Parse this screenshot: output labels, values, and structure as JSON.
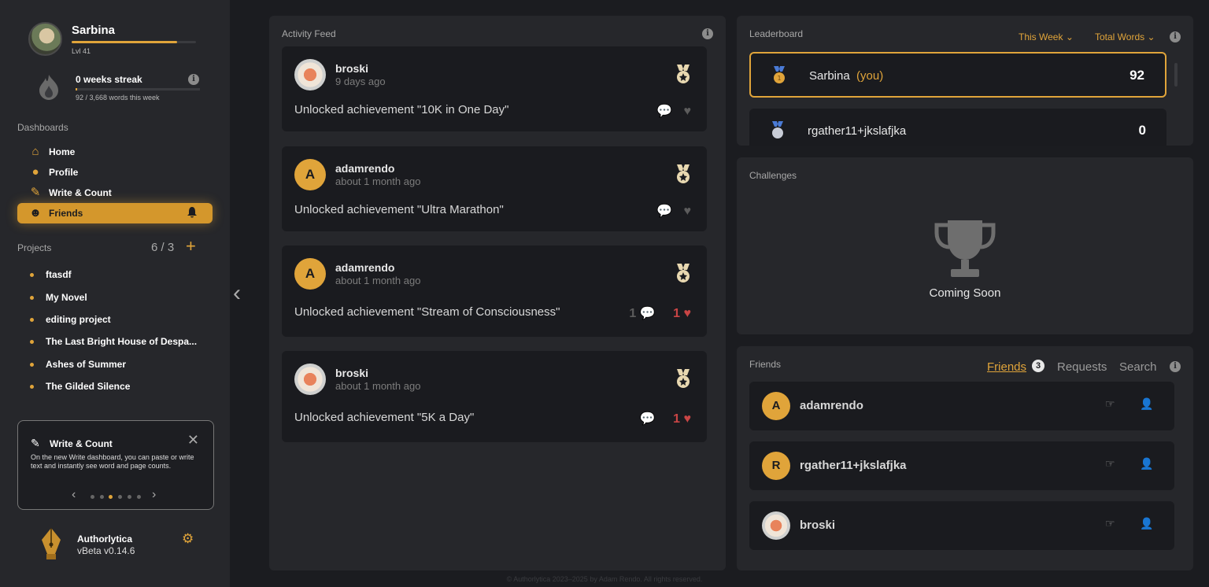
{
  "user": {
    "name": "Sarbina",
    "level": "Lvl 41"
  },
  "streak": {
    "title": "0 weeks streak",
    "sub": "92 / 3,668 words this week"
  },
  "sidebar": {
    "dashboards_label": "Dashboards",
    "nav": [
      {
        "label": "Home",
        "icon": "home-icon"
      },
      {
        "label": "Profile",
        "icon": "user-icon"
      },
      {
        "label": "Write & Count",
        "icon": "pencil-ruler-icon"
      },
      {
        "label": "Friends",
        "icon": "users-icon"
      }
    ],
    "projects_label": "Projects",
    "projects_count": "6 / 3",
    "projects": [
      "ftasdf",
      "My Novel",
      "editing project",
      "The Last Bright House of Despa...",
      "Ashes of Summer",
      "The Gilded Silence"
    ]
  },
  "tip": {
    "title": "Write & Count",
    "body": "On the new Write dashboard, you can paste or write text and instantly see word and page counts.",
    "close": "✕"
  },
  "brand": {
    "name": "Authorlytica",
    "version": "vBeta v0.14.6"
  },
  "activity": {
    "title": "Activity Feed",
    "items": [
      {
        "user": "broski",
        "time": "9 days ago",
        "text": "Unlocked achievement \"10K in One Day\"",
        "comments": "",
        "likes": ""
      },
      {
        "user": "adamrendo",
        "initial": "A",
        "time": "about 1 month ago",
        "text": "Unlocked achievement \"Ultra Marathon\"",
        "comments": "",
        "likes": ""
      },
      {
        "user": "adamrendo",
        "initial": "A",
        "time": "about 1 month ago",
        "text": "Unlocked achievement \"Stream of Consciousness\"",
        "comments": "1",
        "likes": "1"
      },
      {
        "user": "broski",
        "time": "about 1 month ago",
        "text": "Unlocked achievement \"5K a Day\"",
        "comments": "",
        "likes": "1"
      }
    ]
  },
  "leaderboard": {
    "title": "Leaderboard",
    "period": "This Week",
    "metric": "Total Words",
    "rows": [
      {
        "name": "Sarbina",
        "you": "(you)",
        "score": "92"
      },
      {
        "name": "rgather11+jkslafjka",
        "score": "0"
      }
    ]
  },
  "challenges": {
    "title": "Challenges",
    "status": "Coming Soon"
  },
  "friends": {
    "title": "Friends",
    "tabs": [
      "Friends",
      "Requests",
      "Search"
    ],
    "count": "3",
    "list": [
      {
        "name": "adamrendo",
        "initial": "A"
      },
      {
        "name": "rgather11+jkslafjka",
        "initial": "R"
      },
      {
        "name": "broski"
      }
    ]
  },
  "footer": "© Authorlytica 2023–2025 by Adam Rendo. All rights reserved.",
  "colors": {
    "accent": "#e0a43a",
    "like": "#c94545",
    "bg": "#1b1c20",
    "panel": "#26272b",
    "card": "#1a1b1f"
  }
}
